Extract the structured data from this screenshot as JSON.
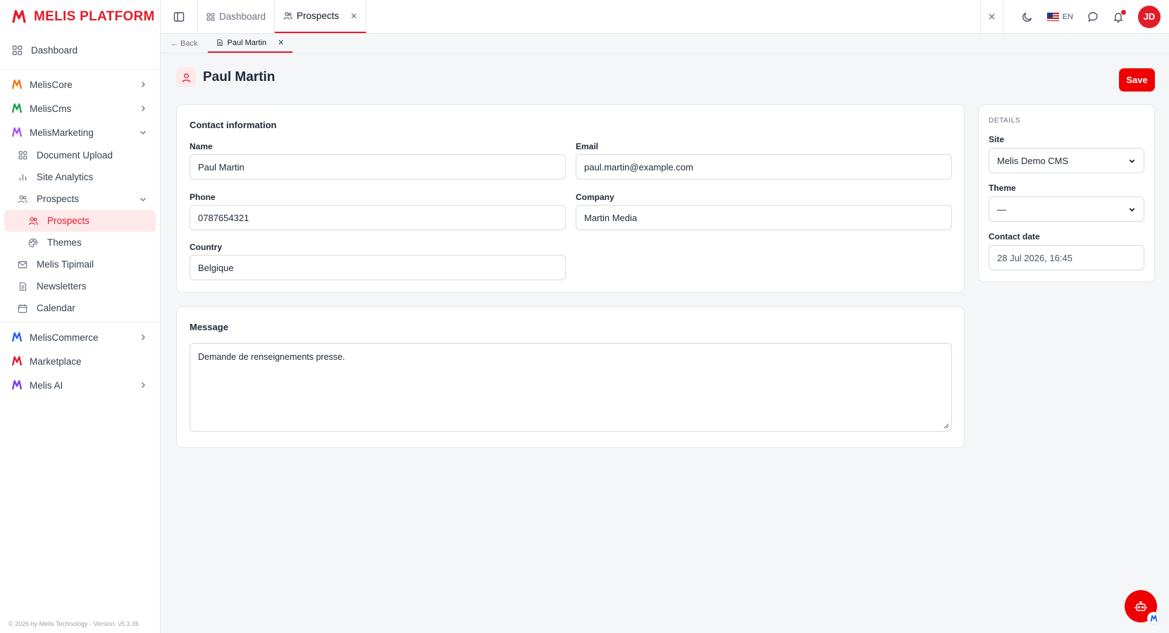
{
  "brand": {
    "name": "MELIS PLATFORM"
  },
  "sidebar": {
    "dashboard": "Dashboard",
    "items": {
      "core": "MelisCore",
      "cms": "MelisCms",
      "marketing": "MelisMarketing",
      "document_upload": "Document Upload",
      "site_analytics": "Site Analytics",
      "prospects": "Prospects",
      "prospects_sub": "Prospects",
      "themes": "Themes",
      "tipimail": "Melis Tipimail",
      "newsletters": "Newsletters",
      "calendar": "Calendar",
      "commerce": "MelisCommerce",
      "marketplace": "Marketplace",
      "ai": "Melis AI"
    },
    "footer": "© 2026 by Melis Technology - Version: v5.3.36"
  },
  "topbar": {
    "tabs": [
      {
        "label": "Dashboard"
      },
      {
        "label": "Prospects"
      }
    ],
    "lang": "EN",
    "avatar": "JD"
  },
  "subbar": {
    "back": "← Back",
    "tab": "Paul Martin"
  },
  "page": {
    "title": "Paul Martin",
    "save_label": "Save"
  },
  "contact": {
    "title": "Contact information",
    "name_label": "Name",
    "name_value": "Paul Martin",
    "email_label": "Email",
    "email_value": "paul.martin@example.com",
    "phone_label": "Phone",
    "phone_value": "0787654321",
    "company_label": "Company",
    "company_value": "Martin Media",
    "country_label": "Country",
    "country_value": "Belgique"
  },
  "message": {
    "title": "Message",
    "value": "Demande de renseignements presse."
  },
  "details": {
    "title": "DETAILS",
    "site_label": "Site",
    "site_value": "Melis Demo CMS",
    "theme_label": "Theme",
    "theme_value": "—",
    "date_label": "Contact date",
    "date_value": "28 Jul 2026, 16:45"
  },
  "colors": {
    "accent": "#e11d2a",
    "save": "#ef0000"
  }
}
